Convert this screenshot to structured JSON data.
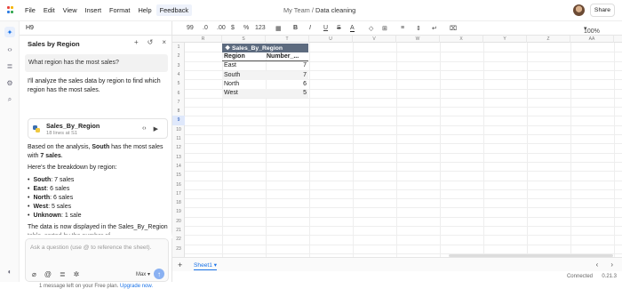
{
  "menu": [
    "File",
    "Edit",
    "View",
    "Insert",
    "Format",
    "Help",
    "Feedback"
  ],
  "breadcrumb": {
    "team": "My Team",
    "separator": "/",
    "doc": "Data cleaning"
  },
  "share_label": "Share",
  "name_box": "H9",
  "zoom": "100%",
  "toolbar": {
    "font_size": "99",
    "dec_less": ".0",
    "dec_more": ".00",
    "currency": "$",
    "percent": "%",
    "number": "123"
  },
  "panel": {
    "title": "Sales by Region",
    "question": "What region has the most sales?",
    "intro": "I'll analyze the sales data by region to find which region has the most sales.",
    "card": {
      "name": "Sales_By_Region",
      "sub": "18 lines at S1"
    },
    "analysis_pre": "Based on the analysis, ",
    "analysis_region": "South",
    "analysis_mid": " has the most sales with ",
    "analysis_count": "7 sales",
    "analysis_end": ".",
    "breakdown_label": "Here's the breakdown by region:",
    "breakdown": [
      {
        "region": "South",
        "value": ": 7 sales"
      },
      {
        "region": "East",
        "value": ": 6 sales"
      },
      {
        "region": "North",
        "value": ": 6 sales"
      },
      {
        "region": "West",
        "value": ": 5 sales"
      },
      {
        "region": "Unknown",
        "value": ": 1 sale"
      }
    ],
    "closing": "The data is now displayed in the Sales_By_Region table, sorted by the number of",
    "ask_placeholder": "Ask a question (use @ to reference the sheet).",
    "model": "Max",
    "footnote_pre": "1 message left on your Free plan. ",
    "footnote_link": "Upgrade now."
  },
  "columns": [
    "R",
    "S",
    "T",
    "U",
    "V",
    "W",
    "X",
    "Y",
    "Z",
    "AA"
  ],
  "rows": [
    "1",
    "2",
    "3",
    "4",
    "5",
    "6",
    "7",
    "8",
    "9",
    "10",
    "11",
    "12",
    "13",
    "14",
    "15",
    "16",
    "17",
    "18",
    "19",
    "20",
    "21",
    "22",
    "23"
  ],
  "selected_row": "9",
  "table": {
    "title": "Sales_By_Region",
    "headers": [
      "Region",
      "Number_..."
    ],
    "rows": [
      [
        "East",
        "7"
      ],
      [
        "South",
        "7"
      ],
      [
        "North",
        "6"
      ],
      [
        "West",
        "5"
      ]
    ]
  },
  "sheet_tab": "Sheet1",
  "status": {
    "connection": "Connected",
    "version": "0.21.3"
  }
}
